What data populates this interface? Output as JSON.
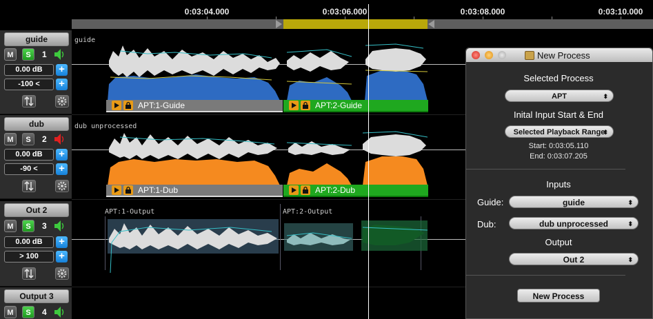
{
  "ruler": {
    "ticks": [
      "0:03:04.000",
      "0:03:06.000",
      "0:03:08.000",
      "0:03:10.000"
    ]
  },
  "tracks": [
    {
      "name": "guide",
      "mute": "M",
      "solo": "S",
      "solo_on": true,
      "number": "1",
      "speaker_color": "#3ec93e",
      "gain": "0.00 dB",
      "offset": "-100 <",
      "lane_label": "guide",
      "regions": [
        "APT:1-Guide",
        "APT:2-Guide"
      ],
      "fill": "#2e6bc2"
    },
    {
      "name": "dub",
      "mute": "M",
      "solo": "S",
      "solo_on": false,
      "number": "2",
      "speaker_color": "#e02020",
      "gain": "0.00 dB",
      "offset": "-90 <",
      "lane_label": "dub unprocessed",
      "regions": [
        "APT:1-Dub",
        "APT:2-Dub"
      ],
      "fill": "#f58a1f"
    },
    {
      "name": "Out 2",
      "mute": "M",
      "solo": "S",
      "solo_on": true,
      "number": "3",
      "speaker_color": "#3ec93e",
      "gain": "0.00 dB",
      "offset": "> 100",
      "region_labels": [
        "APT:1-Output",
        "APT:2-Output"
      ]
    },
    {
      "name": "Output 3",
      "mute": "M",
      "solo": "S",
      "solo_on": true,
      "number": "4",
      "speaker_color": "#3ec93e"
    }
  ],
  "dialog": {
    "title": "New Process",
    "selected_process_heading": "Selected Process",
    "process_value": "APT",
    "range_heading": "Inital Input Start & End",
    "range_value": "Selected Playback Range",
    "start": "Start: 0:03:05.110",
    "end": "End: 0:03:07.205",
    "inputs_heading": "Inputs",
    "guide_label": "Guide:",
    "guide_value": "guide",
    "dub_label": "Dub:",
    "dub_value": "dub unprocessed",
    "output_heading": "Output",
    "output_value": "Out 2",
    "new_process_button": "New Process"
  },
  "colors": {
    "selection": "#b9a80a",
    "region_gray": "#7a7a7a",
    "region_green": "#1fa81f",
    "button_blue": "#2196ee",
    "solo_green": "#2fb92f"
  },
  "icons": [
    "speaker-icon",
    "plus-icon",
    "up-down-arrows-icon",
    "gear-icon",
    "play-icon",
    "lock-icon"
  ]
}
